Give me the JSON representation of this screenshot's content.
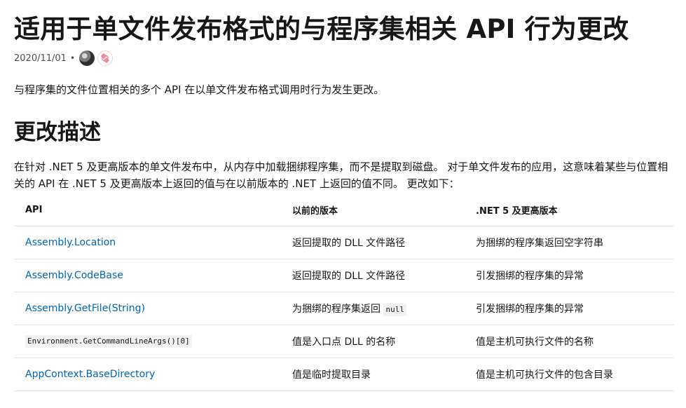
{
  "header": {
    "title": "适用于单文件发布格式的与程序集相关 API 行为更改",
    "date": "2020/11/01",
    "separator": "•"
  },
  "intro": "与程序集的文件位置相关的多个 API 在以单文件发布格式调用时行为发生更改。",
  "section": {
    "title": "更改描述",
    "description": "在针对 .NET 5 及更高版本的单文件发布中，从内存中加载捆绑程序集，而不是提取到磁盘。 对于单文件发布的应用，这意味着某些与位置相关的 API 在 .NET 5 及更高版本上返回的值与在以前版本的 .NET 上返回的值不同。 更改如下："
  },
  "table": {
    "headers": [
      "API",
      "以前的版本",
      ".NET 5 及更高版本"
    ],
    "rows": [
      {
        "api": "Assembly.Location",
        "api_type": "link",
        "previous": "返回提取的 DLL 文件路径",
        "previous_code": "",
        "new": "为捆绑的程序集返回空字符串"
      },
      {
        "api": "Assembly.CodeBase",
        "api_type": "link",
        "previous": "返回提取的 DLL 文件路径",
        "previous_code": "",
        "new": "引发捆绑的程序集的异常"
      },
      {
        "api": "Assembly.GetFile(String)",
        "api_type": "link",
        "previous": "为捆绑的程序集返回",
        "previous_code": "null",
        "new": "引发捆绑的程序集的异常"
      },
      {
        "api": "Environment.GetCommandLineArgs()[0]",
        "api_type": "code",
        "previous": "值是入口点 DLL 的名称",
        "previous_code": "",
        "new": "值是主机可执行文件的名称"
      },
      {
        "api": "AppContext.BaseDirectory",
        "api_type": "link",
        "previous": "值是临时提取目录",
        "previous_code": "",
        "new": "值是主机可执行文件的包含目录"
      }
    ]
  },
  "colors": {
    "text": "#171717",
    "link": "#0065b3",
    "muted": "#505050",
    "border": "#e3e3e3",
    "code_background": "#f2f2f2"
  },
  "icons": {
    "author_avatar_1": "contributor-avatar-icon",
    "author_avatar_2": "contributor-avatar-icon"
  }
}
